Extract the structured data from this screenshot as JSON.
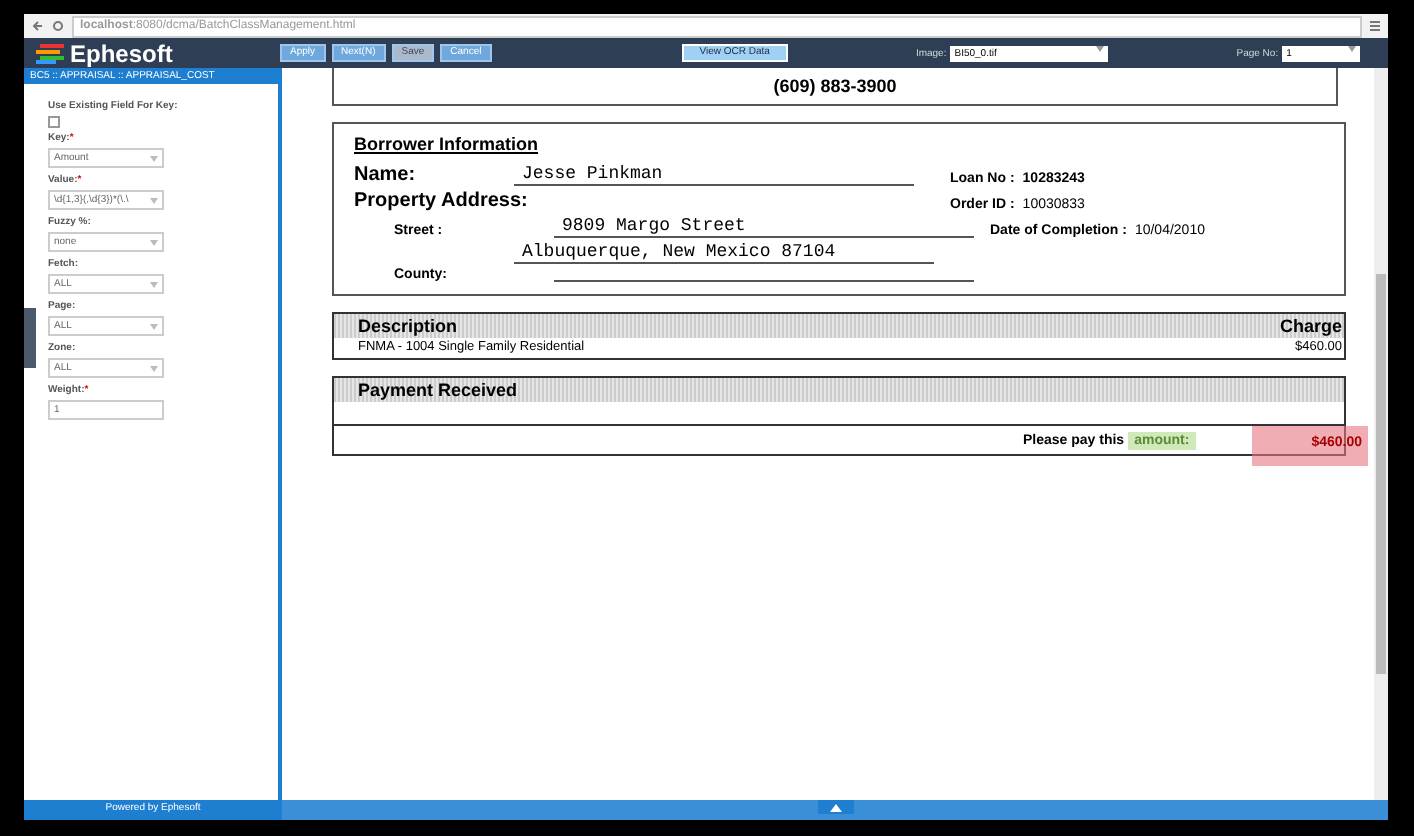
{
  "browser": {
    "url_host": "localhost",
    "url_path": ":8080/dcma/BatchClassManagement.html"
  },
  "header": {
    "logo": "Ephesoft",
    "buttons": [
      {
        "label": "Apply",
        "disabled": false
      },
      {
        "label": "Next(N)",
        "disabled": false
      },
      {
        "label": "Save",
        "disabled": true
      },
      {
        "label": "Cancel",
        "disabled": false
      }
    ],
    "ocr_button": "View OCR Data",
    "image_label": "Image:",
    "image_value": "BI50_0.tif",
    "page_label": "Page No:",
    "page_value": "1"
  },
  "sidebar": {
    "breadcrumb": "BC5 :: APPRAISAL :: APPRAISAL_COST",
    "fields": [
      {
        "kind": "checkbox",
        "label": "Use Existing Field For Key:",
        "checked": false
      },
      {
        "kind": "select",
        "label": "Key:",
        "required_mark": "*",
        "value": "Amount"
      },
      {
        "kind": "select",
        "label": "Value:",
        "required_mark": "*",
        "value": "\\d{1,3}(,\\d{3})*(\\.\\"
      },
      {
        "kind": "select",
        "label": "Fuzzy %:",
        "value": "none"
      },
      {
        "kind": "select",
        "label": "Fetch:",
        "value": "ALL"
      },
      {
        "kind": "select",
        "label": "Page:",
        "value": "ALL"
      },
      {
        "kind": "select",
        "label": "Zone:",
        "value": "ALL"
      },
      {
        "kind": "text",
        "label": "Weight:",
        "required_mark": "*",
        "value": "1"
      }
    ],
    "footer": "Powered by Ephesoft"
  },
  "document": {
    "phone": "(609) 883-3900",
    "section_title": "Borrower Information",
    "name_label": "Name:",
    "name": "Jesse Pinkman",
    "address_label": "Property Address:",
    "street_label": "Street :",
    "street": "9809 Margo Street",
    "city": "Albuquerque, New Mexico 87104",
    "county_label": "County:",
    "right_fields": [
      {
        "label": "Loan No :",
        "value": "10283243",
        "bold": true
      },
      {
        "label": "Order ID :",
        "value": "10030833",
        "bold": false
      },
      {
        "label": "Date of Completion :",
        "value": "10/04/2010",
        "bold": false
      }
    ],
    "charges": {
      "description_header": "Description",
      "charge_header": "Charge",
      "rows": [
        {
          "description": "FNMA - 1004 Single Family Residential",
          "charge": "$460.00"
        }
      ]
    },
    "payment_header": "Payment Received",
    "pay_prefix": "Please pay this",
    "pay_key": "amount:",
    "pay_value": "$460.00"
  }
}
